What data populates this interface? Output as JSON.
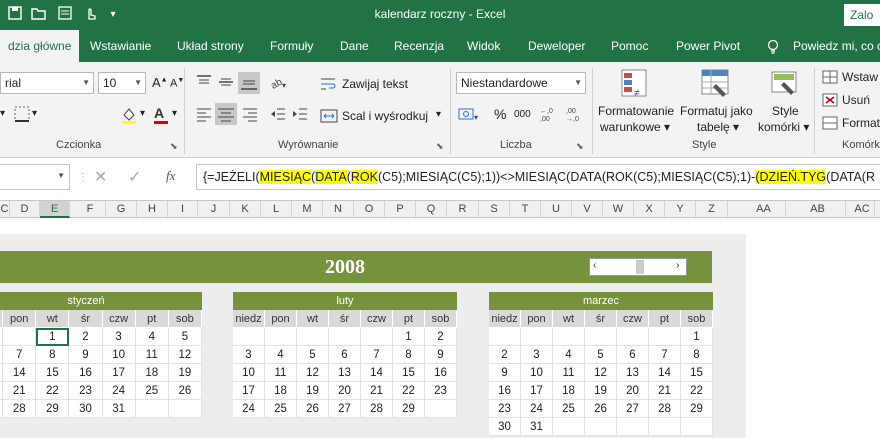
{
  "titlebar": {
    "title": "kalendarz roczny  -  Excel",
    "signin": "Zalo",
    "quick_icons": [
      "save-icon",
      "open-icon",
      "form-icon",
      "touch-icon",
      "customize-icon"
    ]
  },
  "tabs": [
    "dzia główne",
    "Wstawianie",
    "Układ strony",
    "Formuły",
    "Dane",
    "Recenzja",
    "Widok",
    "Deweloper",
    "Pomoc",
    "Power Pivot",
    "Powiedz mi, co c"
  ],
  "ribbon": {
    "font_name": "rial",
    "font_size": "10",
    "group_font": "Czcionka",
    "group_align": "Wyrównanie",
    "wrap_text": "Zawijaj tekst",
    "merge_center": "Scal i wyśrodkuj",
    "number_format": "Niestandardowe",
    "group_number": "Liczba",
    "percent": "%",
    "thousands": "000",
    "cond_format_1": "Formatowanie",
    "cond_format_2": "warunkowe",
    "table_format_1": "Formatuj jako",
    "table_format_2": "tabelę",
    "cell_styles_1": "Style",
    "cell_styles_2": "komórki",
    "group_style": "Style",
    "insert": "Wstaw",
    "delete": "Usuń",
    "format": "Format",
    "group_cells": "Komórk"
  },
  "formula_bar": {
    "fx": "fx",
    "parts": [
      {
        "t": "{=JEŻELI(",
        "h": false
      },
      {
        "t": "MIESIĄC",
        "h": true
      },
      {
        "t": "(",
        "h": false
      },
      {
        "t": "DATA",
        "h": true
      },
      {
        "t": "(",
        "h": false
      },
      {
        "t": "ROK",
        "h": true
      },
      {
        "t": "(C5);MIESIĄC(C5);1))<>MIESIĄC(DATA(ROK(C5);MIESIĄC(C5);1)-",
        "h": false
      },
      {
        "t": "(DZIEŃ.TYG",
        "h": true
      },
      {
        "t": "(DATA(R",
        "h": false
      }
    ]
  },
  "columns": [
    "C",
    "D",
    "E",
    "F",
    "G",
    "H",
    "I",
    "J",
    "K",
    "L",
    "M",
    "N",
    "O",
    "P",
    "Q",
    "R",
    "S",
    "T",
    "U",
    "V",
    "W",
    "X",
    "Y",
    "Z",
    "AA",
    "AB",
    "AC"
  ],
  "selected_column": "E",
  "year": "2008",
  "weekdays": [
    "niedz",
    "pon",
    "wt",
    "śr",
    "czw",
    "pt",
    "sob"
  ],
  "months": [
    {
      "name": "styczeń",
      "rows": [
        [
          "",
          "",
          "1",
          "2",
          "3",
          "4",
          "5"
        ],
        [
          "",
          "7",
          "8",
          "9",
          "10",
          "11",
          "12"
        ],
        [
          "",
          "14",
          "15",
          "16",
          "17",
          "18",
          "19"
        ],
        [
          "",
          "21",
          "22",
          "23",
          "24",
          "25",
          "26"
        ],
        [
          "",
          "28",
          "29",
          "30",
          "31",
          "",
          ""
        ]
      ]
    },
    {
      "name": "luty",
      "rows": [
        [
          "",
          "",
          "",
          "",
          "",
          "1",
          "2"
        ],
        [
          "3",
          "4",
          "5",
          "6",
          "7",
          "8",
          "9"
        ],
        [
          "10",
          "11",
          "12",
          "13",
          "14",
          "15",
          "16"
        ],
        [
          "17",
          "18",
          "19",
          "20",
          "21",
          "22",
          "23"
        ],
        [
          "24",
          "25",
          "26",
          "27",
          "28",
          "29",
          ""
        ]
      ]
    },
    {
      "name": "marzec",
      "rows": [
        [
          "",
          "",
          "",
          "",
          "",
          "",
          "1"
        ],
        [
          "2",
          "3",
          "4",
          "5",
          "6",
          "7",
          "8"
        ],
        [
          "9",
          "10",
          "11",
          "12",
          "13",
          "14",
          "15"
        ],
        [
          "16",
          "17",
          "18",
          "19",
          "20",
          "21",
          "22"
        ],
        [
          "23",
          "24",
          "25",
          "26",
          "27",
          "28",
          "29"
        ],
        [
          "30",
          "31",
          "",
          "",
          "",
          "",
          ""
        ]
      ]
    }
  ],
  "colors": {
    "excel_green": "#217346",
    "calendar_green": "#76923c",
    "highlight": "#ffff00"
  }
}
